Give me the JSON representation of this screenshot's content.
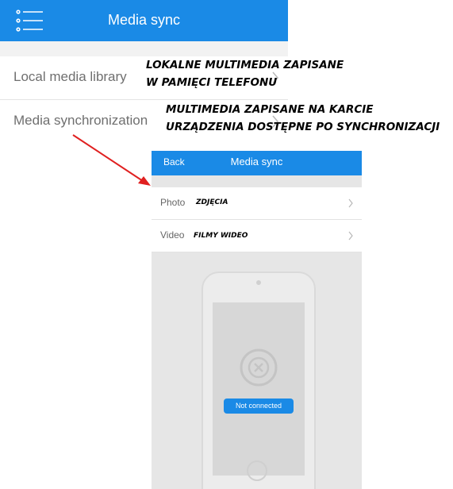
{
  "top_screen": {
    "title": "Media sync",
    "menu_icon": "list-menu-icon",
    "rows": [
      {
        "label": "Local media library",
        "icon": "chevron-right-icon"
      },
      {
        "label": "Media synchronization",
        "icon": "chevron-right-icon"
      }
    ]
  },
  "annotations": {
    "local_line1": "LOKALNE MULTIMEDIA ZAPISANE",
    "local_line2": "W PAMIĘCI TELEFONU",
    "sync_line1": "MULTIMEDIA ZAPISANE NA KARCIE",
    "sync_line2": "URZĄDZENIA DOSTĘPNE PO SYNCHRONIZACJI",
    "photo": "ZDJĘCIA",
    "video": "FILMY WIDEO"
  },
  "bottom_screen": {
    "back_label": "Back",
    "title": "Media sync",
    "rows": [
      {
        "label": "Photo",
        "icon": "chevron-right-icon"
      },
      {
        "label": "Video",
        "icon": "chevron-right-icon"
      }
    ],
    "status_badge": "Not connected",
    "status_icon": "x-circle-icon"
  },
  "colors": {
    "header_blue": "#1a8ae6",
    "arrow_red": "#e02020"
  }
}
